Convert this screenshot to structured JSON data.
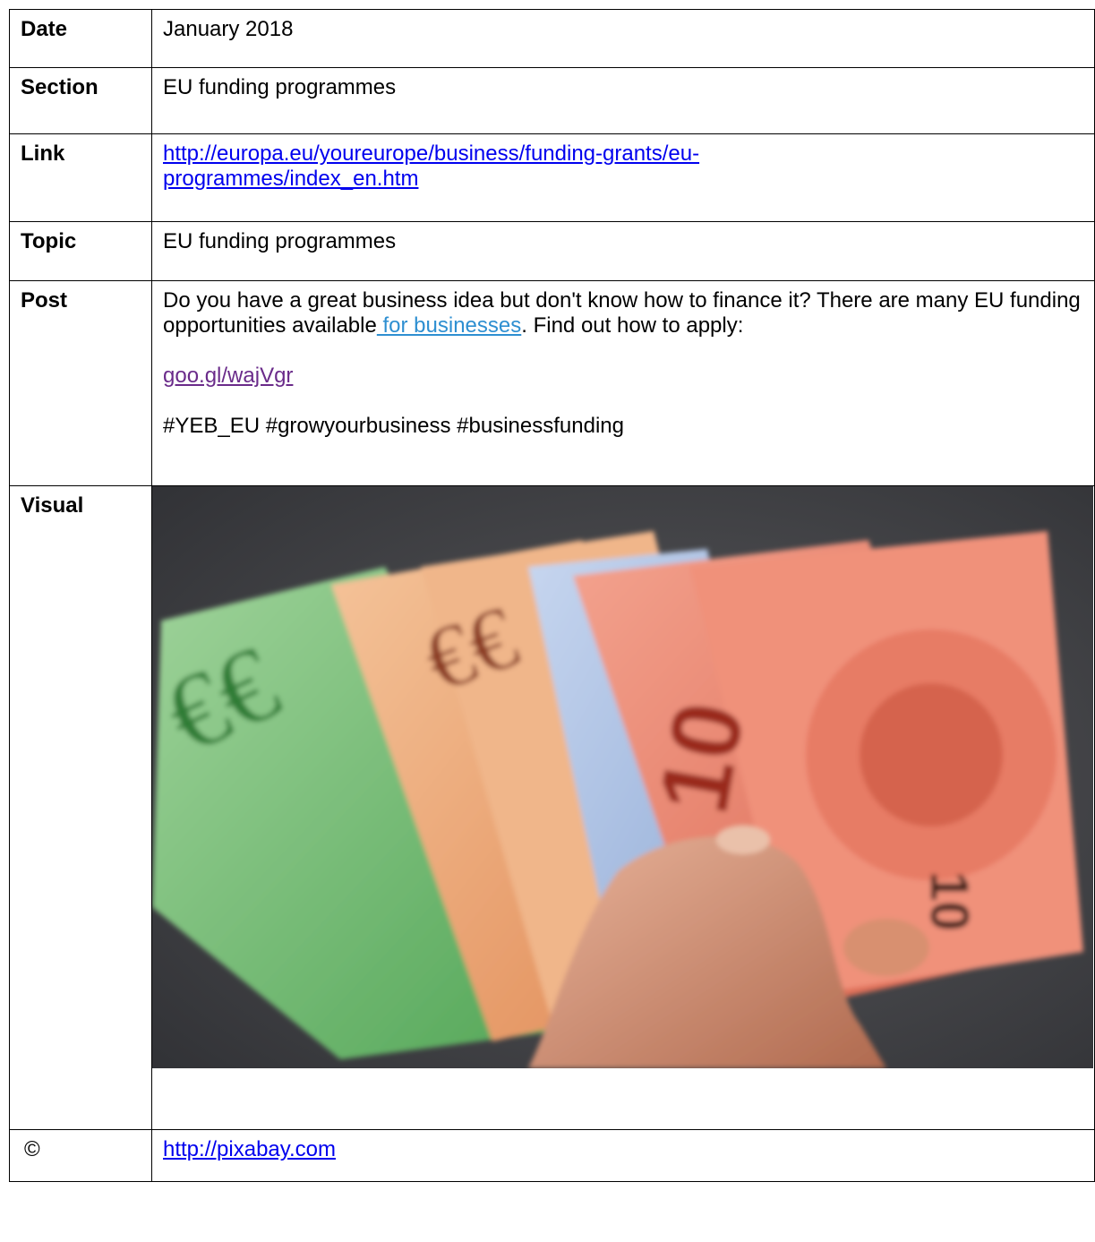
{
  "rows": {
    "date": {
      "label": "Date",
      "value": "January 2018"
    },
    "section": {
      "label": "Section",
      "value": "EU funding programmes"
    },
    "link": {
      "label": "Link",
      "value": "http://europa.eu/youreurope/business/funding-grants/eu-programmes/index_en.htm",
      "line1": "http://europa.eu/youreurope/business/funding-grants/eu-",
      "line2": "programmes/index_en.htm"
    },
    "topic": {
      "label": "Topic",
      "value": "EU funding programmes"
    },
    "post": {
      "label": "Post",
      "text_before": "Do you have a great business idea but don't know how to finance it? There are many EU funding opportunities available",
      "inline_link": " for businesses",
      "text_after": ". Find out how to apply:",
      "short_link": "goo.gl/wajVgr",
      "hashtags": "#YEB_EU #growyourbusiness #businessfunding"
    },
    "visual": {
      "label": "Visual"
    },
    "credit": {
      "label": "©",
      "value": "http://pixabay.com"
    }
  },
  "colors": {
    "link": "#0000ee",
    "inline_link": "#2e8fd1",
    "visited_link": "#6a2b8a",
    "border": "#000000"
  }
}
